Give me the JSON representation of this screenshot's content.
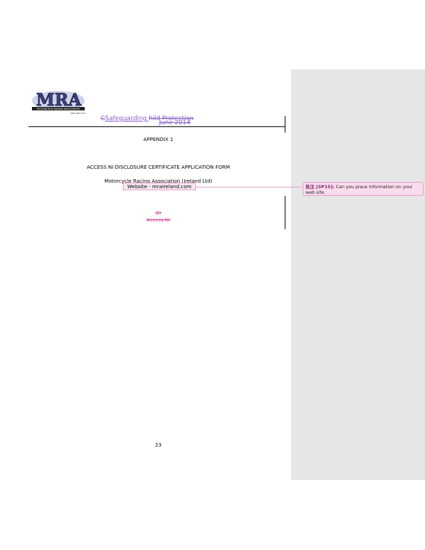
{
  "header": {
    "part1": "C",
    "part2": "Safeguarding ",
    "part3": "hild Protection",
    "date": "June 2014"
  },
  "logo": {
    "letters": "MRA",
    "tagline": "MOTORCYCLE RACING ASSOCIATION",
    "subtitle": "(IRELAND) LTD"
  },
  "document": {
    "appendix": "APPENDIX 1",
    "form_title": "ACCESS NI DISCLOSURE CERTIFICATE APPLICATION FORM",
    "association": "Motorcycle Racing Association (Ireland Ltd)",
    "website": "Website -  mraireland.com",
    "or_text": "Or",
    "access_text": "Access NI",
    "page_number": "23"
  },
  "comment": {
    "author_label": "批注 [SP15]:",
    "text": " Can you place information on your web site"
  },
  "colors": {
    "revision_purple": "#8a5ac8",
    "deletion_pink": "#d64a9a",
    "comment_bg": "#f9dced",
    "comment_pane": "#e6e6e6"
  }
}
